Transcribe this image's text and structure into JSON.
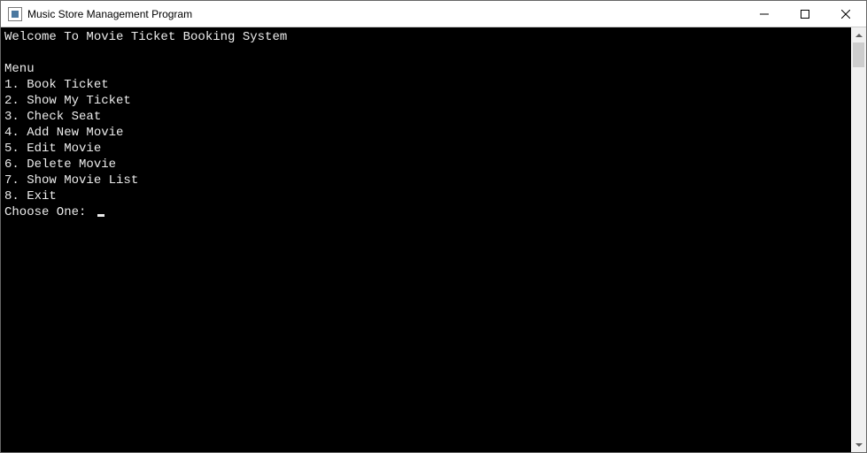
{
  "window": {
    "title": "Music Store Management Program"
  },
  "console": {
    "welcome": "Welcome To Movie Ticket Booking System",
    "menu_header": "Menu",
    "items": [
      "1. Book Ticket",
      "2. Show My Ticket",
      "3. Check Seat",
      "4. Add New Movie",
      "5. Edit Movie",
      "6. Delete Movie",
      "7. Show Movie List",
      "8. Exit"
    ],
    "prompt": "Choose One: "
  }
}
